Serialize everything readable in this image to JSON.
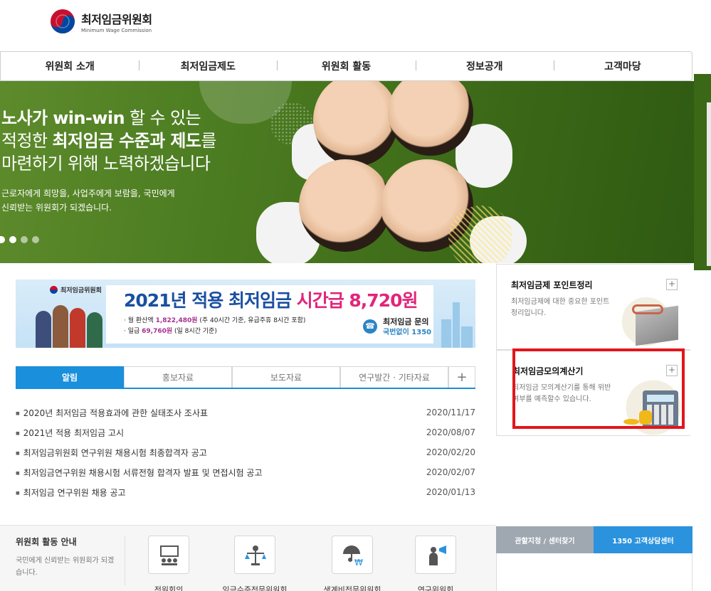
{
  "logo": {
    "name_ko": "최저임금위원회",
    "name_en": "Minimum Wage Commission"
  },
  "gnb": [
    {
      "label": "위원회 소개"
    },
    {
      "label": "최저임금제도"
    },
    {
      "label": "위원회 활동"
    },
    {
      "label": "정보공개"
    },
    {
      "label": "고객마당"
    }
  ],
  "hero": {
    "line1_bold": "노사가 win-win",
    "line1_rest": " 할 수 있는",
    "line2_pre": "적정한 ",
    "line2_bold": "최저임금 수준과 제도",
    "line2_post": "를",
    "line3": "마련하기 위해 노력하겠습니다",
    "sub1": "근로자에게 희망을, 사업주에게 보람을, 국민에게",
    "sub2": "신뢰받는 위원회가 되겠습니다."
  },
  "banner": {
    "logo": "최저임금위원회",
    "title_main": "2021년 적용 최저임금 ",
    "title_accent": "시간급 8,720원",
    "line1_pre": "· 월 환산액 ",
    "line1_val": "1,822,480원",
    "line1_post": " (주 40시간 기준, 유급주휴 8시간 포함)",
    "line2_pre": "· 일급 ",
    "line2_val": "69,760원",
    "line2_post": " (일 8시간 기준)",
    "contact_label": "최저임금 문의",
    "contact_num": "국번없이 1350"
  },
  "tabs": [
    {
      "label": "알림"
    },
    {
      "label": "홍보자료"
    },
    {
      "label": "보도자료"
    },
    {
      "label": "연구발간 · 기타자료"
    },
    {
      "label": "+"
    }
  ],
  "news": [
    {
      "title": "2020년 최저임금 적용효과에 관한 실태조사 조사표",
      "date": "2020/11/17"
    },
    {
      "title": "2021년 적용 최저임금 고시",
      "date": "2020/08/07"
    },
    {
      "title": "최저임금위원회 연구위원 채용시험 최종합격자 공고",
      "date": "2020/02/20"
    },
    {
      "title": "최저임금연구위원 채용시험 서류전형 합격자 발표 및 면접시험 공고",
      "date": "2020/02/07"
    },
    {
      "title": "최저임금 연구위원 채용 공고",
      "date": "2020/01/13"
    }
  ],
  "side": {
    "box1": {
      "title": "최저임금제 포인트정리",
      "desc": "최저임금제에 대한 중요한 포인트 정리입니다.",
      "plus": "+"
    },
    "box2": {
      "title": "최저임금모의계산기",
      "desc": "최저임금 모의계산기를 통해 위반 여부를 예측할수 있습니다.",
      "plus": "+"
    }
  },
  "activity": {
    "title": "위원회 활동 안내",
    "desc": "국민에게 신뢰받는 위원회가 되겠습니다.",
    "items": [
      {
        "label": "전원회의"
      },
      {
        "label": "임금수준전문위원회"
      },
      {
        "label": "생계비전문위원회"
      },
      {
        "label": "연구위원회"
      }
    ]
  },
  "bottom_tabs": [
    {
      "label": "관할지청 / 센터찾기"
    },
    {
      "label": "1350 고객상담센터"
    }
  ]
}
